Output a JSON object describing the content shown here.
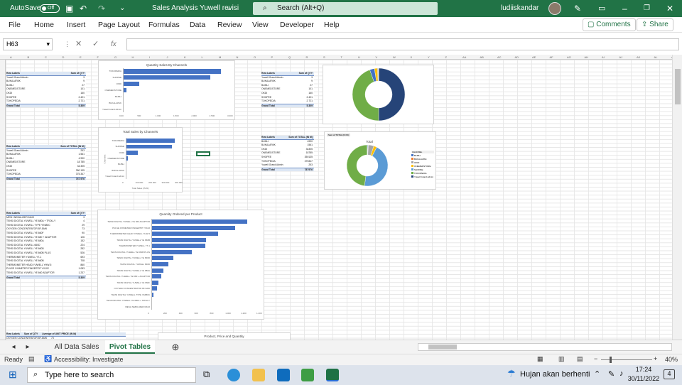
{
  "title_bar": {
    "autosave_label": "AutoSave",
    "autosave_state": "Off",
    "document_title": "Sales Analysis Yuwell revisi",
    "search_placeholder": "Search (Alt+Q)",
    "user_name": "ludiiskandar"
  },
  "ribbon_tabs": [
    "File",
    "Home",
    "Insert",
    "Page Layout",
    "Formulas",
    "Data",
    "Review",
    "View",
    "Developer",
    "Help"
  ],
  "ribbon_actions": {
    "comments": "Comments",
    "share": "Share"
  },
  "formula_bar": {
    "name_box": "H63",
    "formula": ""
  },
  "columns": [
    "A",
    "B",
    "C",
    "D",
    "E",
    "F",
    "G",
    "H",
    "I",
    "J",
    "K",
    "L",
    "M",
    "N",
    "O",
    "P",
    "Q",
    "R",
    "S",
    "T",
    "U",
    "V",
    "W",
    "X",
    "Y",
    "Z",
    "AA",
    "AB",
    "AC",
    "AD",
    "AE",
    "AF",
    "AG",
    "AH",
    "AI",
    "AJ",
    "AK",
    "AL",
    "AM"
  ],
  "pivot_qty_channels": {
    "headers": [
      "Row Labels",
      "Sum of QTY"
    ],
    "rows": [
      [
        "Yuwell Grand Admin",
        "3"
      ],
      [
        "BUKALAPAK",
        "9"
      ],
      [
        "BLIBLI",
        "27"
      ],
      [
        "ONEMEDSTORE",
        "101"
      ],
      [
        "OKDI",
        "160"
      ],
      [
        "SHOPEE",
        "2.421"
      ],
      [
        "TOKOPEDIA",
        "2.721"
      ]
    ],
    "total": [
      "Grand Total",
      "5.309"
    ]
  },
  "pivot_total_channels": {
    "headers": [
      "Row Labels",
      "Sum of TOTAL (IN M)"
    ],
    "rows": [
      [
        "Yuwell Grand Admin",
        "253"
      ],
      [
        "BUKALAPAK",
        "1.561"
      ],
      [
        "BLIBLI",
        "4.990"
      ],
      [
        "ONEMEDSTORE",
        "18.785"
      ],
      [
        "OKDI",
        "34.305"
      ],
      [
        "SHOPEE",
        "350.135"
      ],
      [
        "TOKOPEDIA",
        "375.347"
      ]
    ],
    "total": [
      "Grand Total",
      "787.976"
    ]
  },
  "pivot_qty_channels_right": {
    "headers": [
      "Row Labels",
      "Sum of QTY"
    ],
    "rows": [
      [
        "Yuwell Grand Admin",
        "3"
      ],
      [
        "BUKALAPAK",
        "9"
      ],
      [
        "BLIBLI",
        "27"
      ],
      [
        "ONEMEDSTORE",
        "101"
      ],
      [
        "OKDI",
        "160"
      ],
      [
        "SHOPEE",
        "2.421"
      ],
      [
        "TOKOPEDIA",
        "2.721"
      ]
    ],
    "total": [
      "Grand Total",
      "5.309"
    ]
  },
  "pivot_total_right": {
    "headers": [
      "Row Labels",
      "Sum of TOTAL (IN M)"
    ],
    "rows": [
      [
        "BLIBLI",
        "4990"
      ],
      [
        "BUKALAPAK",
        "1561"
      ],
      [
        "OKDI",
        "34305"
      ],
      [
        "ONEMEDSTORE",
        "18785"
      ],
      [
        "SHOPEE",
        "350135"
      ],
      [
        "TOKOPEDIA",
        "375347"
      ],
      [
        "Yuwell Grand Admin",
        "253"
      ]
    ],
    "total": [
      "Grand Total",
      "787976"
    ]
  },
  "pivot_products": {
    "headers": [
      "Row Labels",
      "Sum of QTY"
    ],
    "rows": [
      [
        "MESH NEBULIZER M102",
        "3"
      ],
      [
        "TENSI DIGITAL YUWELL YE 680A + TROLLY",
        "4"
      ],
      [
        "TENSI DIGITAL YUWELL TYPE YE680C",
        "29"
      ],
      [
        "OXYGEN CONCENTRATOR 8F-5AW",
        "73"
      ],
      [
        "TENSI DIGITAL YUWELL YE 660F",
        "90"
      ],
      [
        "TENSI DIGITAL YUWELL YE 680 + ADAPTOR",
        "126"
      ],
      [
        "TENSI DIGITAL YUWELL YE 680A",
        "152"
      ],
      [
        "TENSI DIGITAL YUWELL 660D",
        "224"
      ],
      [
        "TENSI DIGITAL YUWELL YE 660D",
        "282"
      ],
      [
        "TENSI DIGITAL YUWELL YE 660B PLUS",
        "526"
      ],
      [
        "THERMOMETER YUWELL YT-1",
        "693"
      ],
      [
        "TENSI DIGITAL YUWELL YE 660B",
        "708"
      ],
      [
        "THERMOMETER HEAD YUWELL YHW-5",
        "860"
      ],
      [
        "PULSE OXIMETER FINGERTIP YX102",
        "1.083"
      ],
      [
        "TENSI DIGITAL YUWELL YE 660 ADAPTOR",
        "1.237"
      ]
    ],
    "total": [
      "Grand Total",
      "5.309"
    ]
  },
  "pivot_bottom": {
    "headers": [
      "Row Labels",
      "Sum of QTY",
      "Average of UNIT PRICE (IN M)"
    ],
    "row": [
      "OXYGEN CONCENTRATOR 8F-5AW",
      "73"
    ]
  },
  "bottom_title": "Product, Price and Quantity",
  "chart_data": [
    {
      "type": "bar",
      "title": "Quantity Sales By Channels",
      "categories": [
        "TOKOPEDIA",
        "SHOPEE",
        "OKDI",
        "ONEMEDSTORE",
        "BLIBLI",
        "BUKALAPAK",
        "Yuwell Grand Admin"
      ],
      "values": [
        2721,
        2421,
        460,
        101,
        27,
        9,
        3
      ],
      "xlim": [
        0,
        3000
      ],
      "xticks": [
        "0,00",
        "500",
        "1.000",
        "1.500",
        "2.000",
        "2.500",
        "3.000"
      ]
    },
    {
      "type": "bar",
      "title": "Total Sales by Channels",
      "categories": [
        "TOKOPEDIA",
        "SHOPEE",
        "OKDI",
        "ONEMEDSTORE",
        "BLIBLI",
        "BUKALAPAK",
        "Yuwell Grand Admin"
      ],
      "values": [
        375347,
        350135,
        94305,
        18785,
        4990,
        1561,
        253
      ],
      "xlim": [
        0,
        400000
      ],
      "xticks": [
        "0",
        "100.000",
        "200.000",
        "300.000",
        "400.000"
      ],
      "xlabel": "Total Sales (IN M)",
      "ylabel": "Channels"
    },
    {
      "type": "pie",
      "title": "",
      "labels": [
        "TOKOPEDIA",
        "SHOPEE",
        "OKDI",
        "ONEMEDSTORE",
        "BLIBLI",
        "BUKALAPAK",
        "Yuwell Grand Admin"
      ],
      "values": [
        2721,
        2421,
        160,
        101,
        27,
        9,
        3
      ],
      "colors": [
        "#264478",
        "#70ad47",
        "#4472c4",
        "#ffc000",
        "#a5a5a5",
        "#ed7d31",
        "#5b9bd5"
      ]
    },
    {
      "type": "pie",
      "title": "Total",
      "filter_label": "Sum of TOTAL (IN M)",
      "legend_header": "CHANNEL",
      "labels": [
        "BLIBLI",
        "BUKALAPAK",
        "OKDI",
        "ONEMEDSTORE",
        "SHOPEE",
        "TOKOPEDIA",
        "Yuwell Grand Admin"
      ],
      "values": [
        4990,
        1561,
        34305,
        18785,
        350135,
        375347,
        253
      ],
      "colors": [
        "#4472c4",
        "#ed7d31",
        "#a5a5a5",
        "#ffc000",
        "#5b9bd5",
        "#70ad47",
        "#264478"
      ]
    },
    {
      "type": "bar",
      "title": "Quantity Ordered per Product",
      "categories": [
        "TENSI DIGITAL YUWELL YE 660 ADAPTOR",
        "PULSE OXIMETER FINGERTIP YX102",
        "THERMOMETER HEAD YUWELL YHW-5",
        "TENSI DIGITAL YUWELL YE 660B",
        "THERMOMETER YUWELL YT-1",
        "TENSI DIGITAL YUWELL YE 660B PLUS",
        "TENSI DIGITAL YUWELL YE 660D",
        "TENSI DIGITAL YUWELL 660D",
        "TENSI DIGITAL YUWELL YE 680A",
        "TENSI DIGITAL YUWELL YE 680 + ADAPTOR",
        "TENSI DIGITAL YUWELL YE 660F",
        "OXYGEN CONCENTRATOR 8F-5AW",
        "TENSI DIGITAL YUWELL TYPE YE680C",
        "TENSI DIGITAL YUWELL YE 680A + TROLLY",
        "MESH NEBULIZER M102"
      ],
      "values": [
        1237,
        1083,
        860,
        708,
        693,
        526,
        282,
        224,
        152,
        126,
        90,
        73,
        29,
        4,
        3
      ],
      "xlim": [
        0,
        1400
      ],
      "xticks": [
        "0",
        "200",
        "400",
        "600",
        "800",
        "1.000",
        "1.200",
        "1.400"
      ]
    }
  ],
  "sheet_tabs": [
    "All Data Sales",
    "Pivot Tables"
  ],
  "status": {
    "ready": "Ready",
    "accessibility": "Accessibility: Investigate",
    "zoom": "40%"
  },
  "taskbar": {
    "search_placeholder": "Type here to search",
    "weather": "Hujan akan berhenti",
    "time": "17:24",
    "date": "30/11/2022",
    "notifications": "4"
  }
}
